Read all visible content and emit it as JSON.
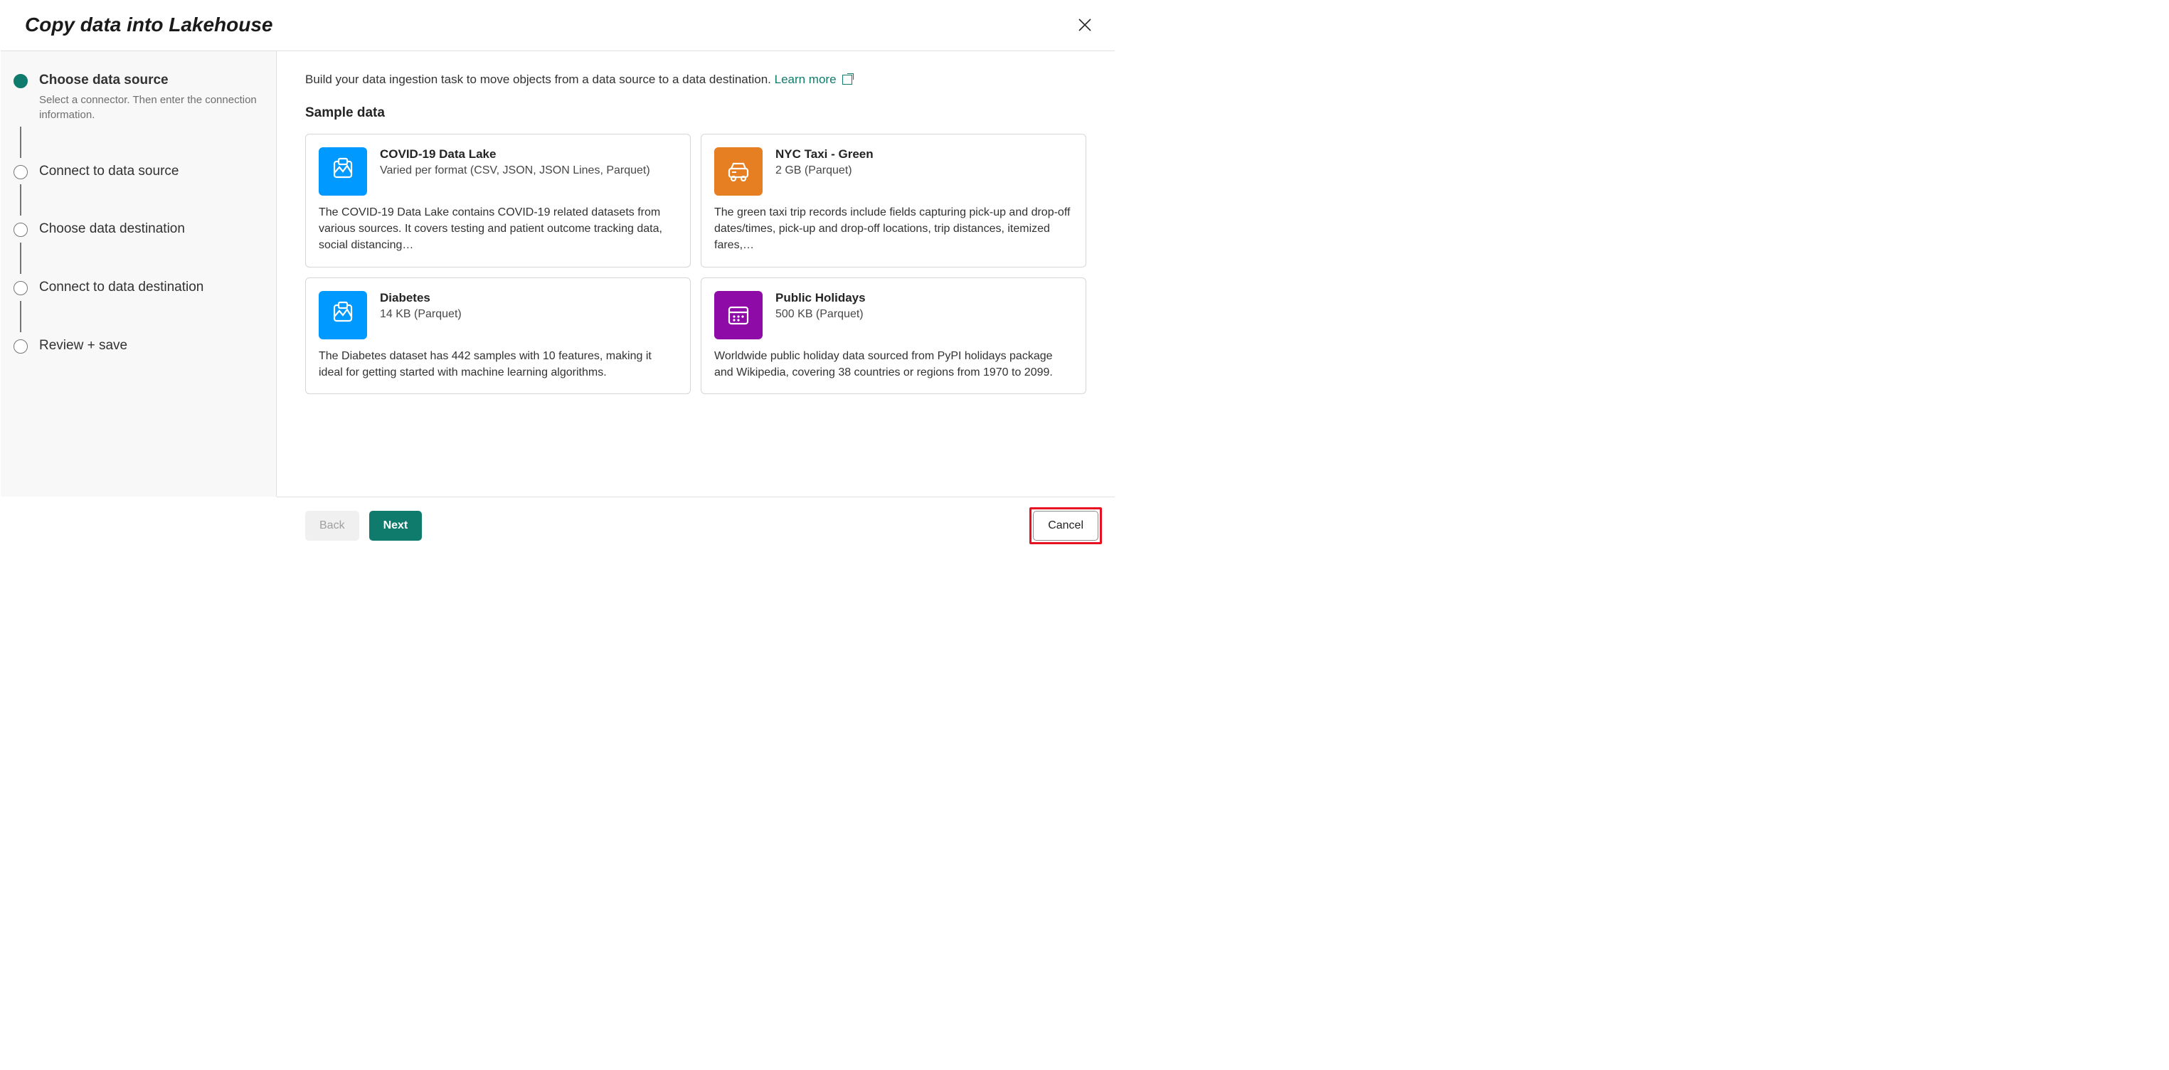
{
  "header": {
    "title": "Copy data into Lakehouse"
  },
  "sidebar": {
    "steps": [
      {
        "title": "Choose data source",
        "desc": "Select a connector. Then enter the connection information."
      },
      {
        "title": "Connect to data source",
        "desc": ""
      },
      {
        "title": "Choose data destination",
        "desc": ""
      },
      {
        "title": "Connect to data destination",
        "desc": ""
      },
      {
        "title": "Review + save",
        "desc": ""
      }
    ]
  },
  "main": {
    "intro_text": "Build your data ingestion task to move objects from a data source to a data destination. ",
    "learn_more": "Learn more",
    "section_title": "Sample data",
    "cards": [
      {
        "title": "COVID-19 Data Lake",
        "subtitle": "Varied per format (CSV, JSON, JSON Lines, Parquet)",
        "body": "The COVID-19 Data Lake contains COVID-19 related datasets from various sources. It covers testing and patient outcome tracking data, social distancing…",
        "icon_color": "blue",
        "icon_name": "data-lake-monitor-icon"
      },
      {
        "title": "NYC Taxi - Green",
        "subtitle": "2 GB (Parquet)",
        "body": "The green taxi trip records include fields capturing pick-up and drop-off dates/times, pick-up and drop-off locations, trip distances, itemized fares,…",
        "icon_color": "orange",
        "icon_name": "taxi-icon"
      },
      {
        "title": "Diabetes",
        "subtitle": "14 KB (Parquet)",
        "body": "The Diabetes dataset has 442 samples with 10 features, making it ideal for getting started with machine learning algorithms.",
        "icon_color": "blue",
        "icon_name": "data-lake-monitor-icon"
      },
      {
        "title": "Public Holidays",
        "subtitle": "500 KB (Parquet)",
        "body": "Worldwide public holiday data sourced from PyPI holidays package and Wikipedia, covering 38 countries or regions from 1970 to 2099.",
        "icon_color": "purple",
        "icon_name": "calendar-icon"
      }
    ]
  },
  "footer": {
    "back": "Back",
    "next": "Next",
    "cancel": "Cancel"
  }
}
